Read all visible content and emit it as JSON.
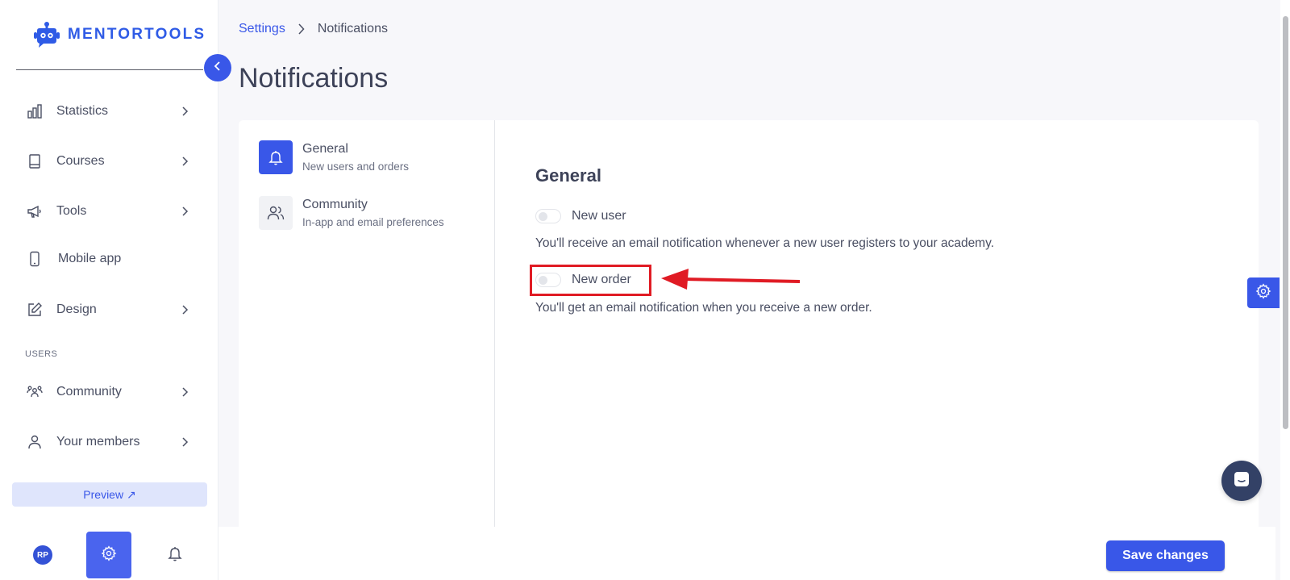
{
  "brand": {
    "name": "MENTORTOOLS",
    "accent": "#3957e8"
  },
  "sidebar": {
    "items": [
      {
        "label": "Statistics",
        "icon": "bar-chart-icon",
        "has_chevron": true
      },
      {
        "label": "Courses",
        "icon": "book-icon",
        "has_chevron": true
      },
      {
        "label": "Tools",
        "icon": "megaphone-icon",
        "has_chevron": true
      },
      {
        "label": "Mobile app",
        "icon": "smartphone-icon",
        "has_chevron": false
      },
      {
        "label": "Design",
        "icon": "pencil-icon",
        "has_chevron": true
      }
    ],
    "users_section_label": "USERS",
    "user_items": [
      {
        "label": "Community",
        "icon": "people-group-icon",
        "has_chevron": true
      },
      {
        "label": "Your members",
        "icon": "person-icon",
        "has_chevron": true
      }
    ],
    "preview_label": "Preview ↗",
    "avatar_initials": "RP"
  },
  "breadcrumb": {
    "parent": "Settings",
    "current": "Notifications"
  },
  "page_title": "Notifications",
  "submenu": [
    {
      "title": "General",
      "subtitle": "New users and orders",
      "icon": "bell-icon",
      "active": true
    },
    {
      "title": "Community",
      "subtitle": "In-app and email preferences",
      "icon": "users-icon",
      "active": false
    }
  ],
  "general_section": {
    "title": "General",
    "settings": [
      {
        "label": "New user",
        "description": "You'll receive an email notification whenever a new user registers to your academy.",
        "enabled": false
      },
      {
        "label": "New order",
        "description": "You'll get an email notification when you receive a new order.",
        "enabled": false
      }
    ]
  },
  "footer": {
    "save_label": "Save changes"
  },
  "annotation": {
    "color": "#e01b24"
  }
}
